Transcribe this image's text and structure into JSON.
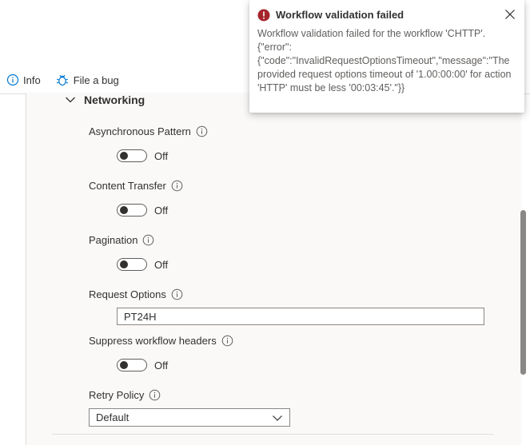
{
  "toolbar": {
    "info_label": "Info",
    "bug_label": "File a bug"
  },
  "section": {
    "title": "Networking"
  },
  "fields": {
    "async": {
      "label": "Asynchronous Pattern",
      "state": "Off"
    },
    "content_transfer": {
      "label": "Content Transfer",
      "state": "Off"
    },
    "pagination": {
      "label": "Pagination",
      "state": "Off"
    },
    "request_options": {
      "label": "Request Options",
      "value": "PT24H"
    },
    "suppress_headers": {
      "label": "Suppress workflow headers",
      "state": "Off"
    },
    "retry_policy": {
      "label": "Retry Policy",
      "value": "Default"
    }
  },
  "toast": {
    "title": "Workflow validation failed",
    "message": "Workflow validation failed for the workflow 'CHTTP'. {\"error\":{\"code\":\"InvalidRequestOptionsTimeout\",\"message\":\"The provided request options timeout of '1.00:00:00' for action 'HTTP' must be less '00:03:45'.\"}}"
  },
  "colors": {
    "error": "#a4262c",
    "accent": "#0078d4",
    "toggle_border": "#605e5c"
  }
}
